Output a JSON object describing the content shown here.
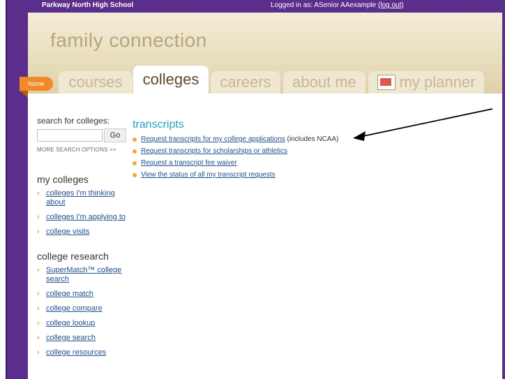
{
  "topbar": {
    "school": "Parkway North High School",
    "logged_in_prefix": "Logged in as: ",
    "user": "ASenior AAexample",
    "logout": "(log out)"
  },
  "brand": "family connection",
  "tabs": {
    "home": "home",
    "courses": "courses",
    "colleges": "colleges",
    "careers": "careers",
    "about_me": "about me",
    "my_planner": "my planner"
  },
  "search": {
    "label": "search for colleges:",
    "placeholder": "",
    "go": "Go",
    "more": "MORE SEARCH OPTIONS >>"
  },
  "my_colleges": {
    "title": "my colleges",
    "items": [
      "colleges I'm thinking about",
      "colleges I'm applying to",
      "college visits"
    ]
  },
  "college_research": {
    "title": "college research",
    "items": [
      "SuperMatch™ college search",
      "college match",
      "college compare",
      "college lookup",
      "college search",
      "college resources"
    ]
  },
  "transcripts": {
    "title": "transcripts",
    "links": [
      {
        "text": "Request transcripts for my college applications",
        "suffix": " (includes NCAA)"
      },
      {
        "text": "Request transcripts for scholarships or athletics",
        "suffix": ""
      },
      {
        "text": "Request a transcript fee waiver",
        "suffix": ""
      },
      {
        "text": "View the status of all my transcript requests",
        "suffix": ""
      }
    ]
  },
  "colors": {
    "purple": "#5b2e8c",
    "orange": "#f08a27",
    "accent_blue": "#2a9cc0",
    "link_blue": "#1f4f8a",
    "bullet": "#f4a733"
  }
}
